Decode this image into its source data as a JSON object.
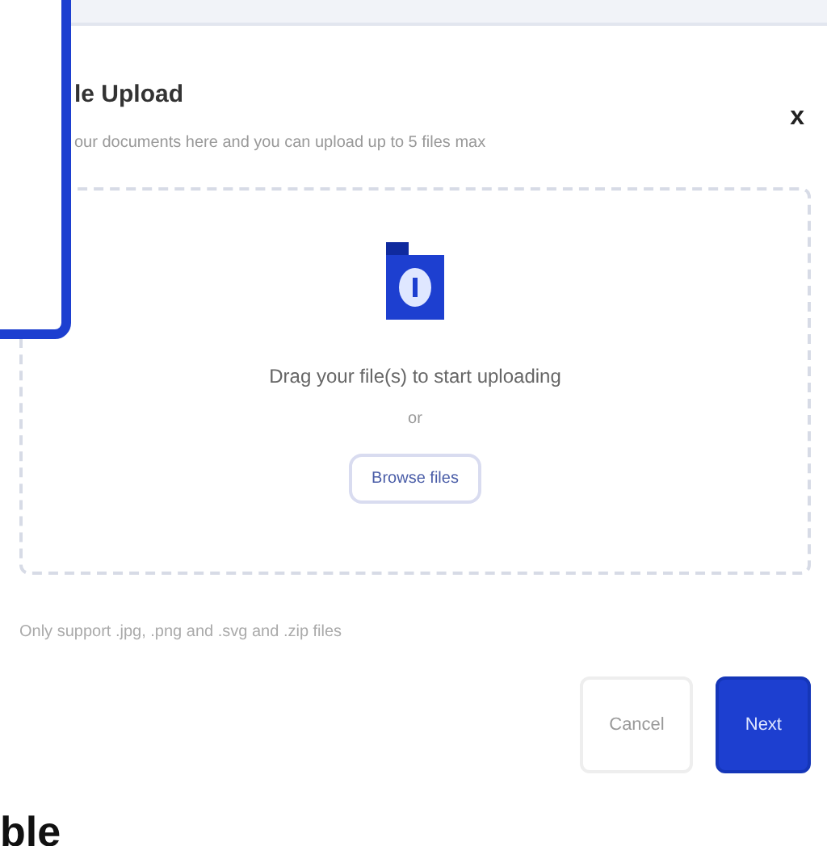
{
  "dialog": {
    "title": "le Upload",
    "subtitle": "our documents here and you can upload up to 5 files max",
    "close": "x"
  },
  "dropzone": {
    "prompt": "Drag your file(s) to start uploading",
    "separator": "or",
    "browse": "Browse files"
  },
  "note": "Only support .jpg, .png and .svg and .zip files",
  "buttons": [
    {
      "label": "Cancel",
      "kind": "secondary"
    },
    {
      "label": "Next",
      "kind": "primary"
    }
  ],
  "background_heading": "ble"
}
